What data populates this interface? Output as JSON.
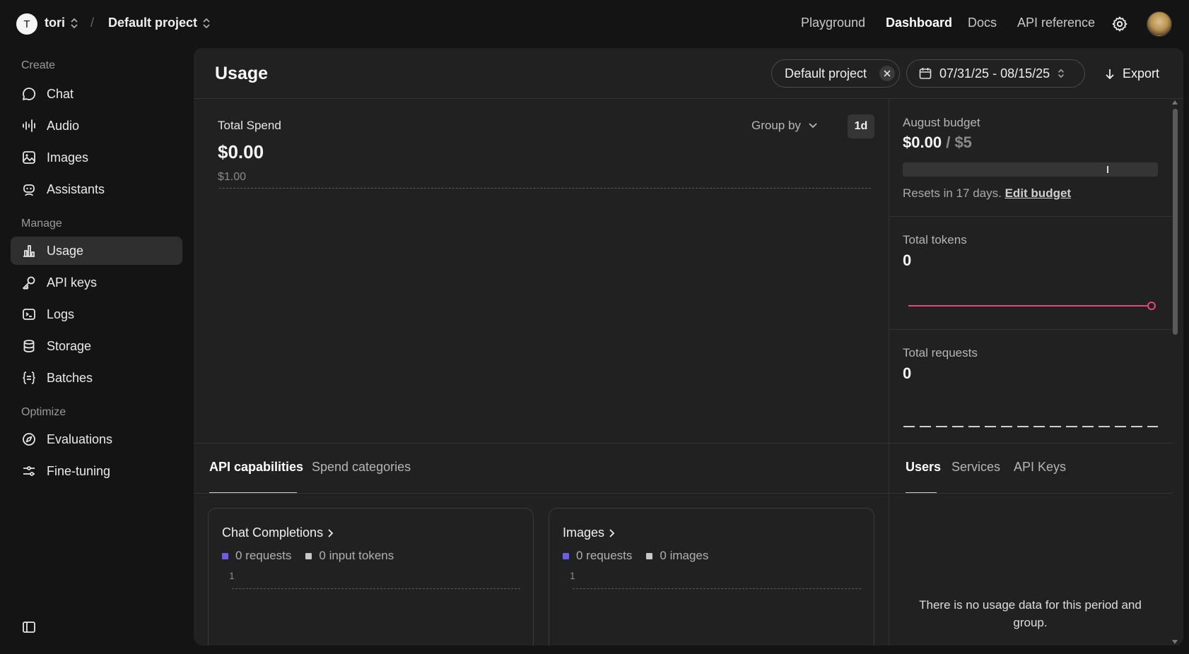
{
  "header": {
    "org_initial": "T",
    "org_name": "tori",
    "separator": "/",
    "project_name": "Default project",
    "nav": [
      "Playground",
      "Dashboard",
      "Docs",
      "API reference"
    ],
    "active_nav": "Dashboard",
    "icons": {
      "settings": "gear-icon",
      "avatar": "user-avatar"
    }
  },
  "sidebar": {
    "sections": [
      {
        "label": "Create",
        "items": [
          {
            "label": "Chat",
            "icon": "chat-bubble-icon"
          },
          {
            "label": "Audio",
            "icon": "audio-waveform-icon"
          },
          {
            "label": "Images",
            "icon": "image-icon"
          },
          {
            "label": "Assistants",
            "icon": "robot-icon"
          }
        ]
      },
      {
        "label": "Manage",
        "items": [
          {
            "label": "Usage",
            "icon": "bar-chart-icon",
            "active": true
          },
          {
            "label": "API keys",
            "icon": "key-icon"
          },
          {
            "label": "Logs",
            "icon": "terminal-icon"
          },
          {
            "label": "Storage",
            "icon": "database-icon"
          },
          {
            "label": "Batches",
            "icon": "braces-icon"
          }
        ]
      },
      {
        "label": "Optimize",
        "items": [
          {
            "label": "Evaluations",
            "icon": "compass-icon"
          },
          {
            "label": "Fine-tuning",
            "icon": "sliders-icon"
          }
        ]
      }
    ],
    "toggle_icon": "sidebar-toggle-icon"
  },
  "usage": {
    "title": "Usage",
    "filters": {
      "project": "Default project",
      "date_range": "07/31/25 - 08/15/25"
    },
    "export_label": "Export",
    "spend": {
      "label": "Total Spend",
      "value": "$0.00",
      "axis_max": "$1.00",
      "group_by_label": "Group by",
      "interval": "1d"
    },
    "budget": {
      "label": "August budget",
      "spent": "$0.00",
      "separator": "/",
      "limit": "$5",
      "fill_fraction": 0.0,
      "threshold_fraction": 0.8,
      "resets_text": "Resets in 17 days.",
      "edit_link": "Edit budget"
    },
    "tokens": {
      "label": "Total tokens",
      "value": "0"
    },
    "requests": {
      "label": "Total requests",
      "value": "0"
    },
    "tabs_left": [
      "API capabilities",
      "Spend categories"
    ],
    "tabs_right": [
      "Users",
      "Services",
      "API Keys"
    ],
    "cards": [
      {
        "title": "Chat Completions",
        "legend": [
          "0 requests",
          "0 input tokens"
        ],
        "tick": "1"
      },
      {
        "title": "Images",
        "legend": [
          "0 requests",
          "0 images"
        ],
        "tick": "1"
      }
    ],
    "empty_message": "There is no usage data for this period and group.",
    "colors": {
      "accent_purple": "#6e5fe0",
      "legend_gray": "#c8c8c8",
      "tokens_line": "#e8457a"
    }
  }
}
